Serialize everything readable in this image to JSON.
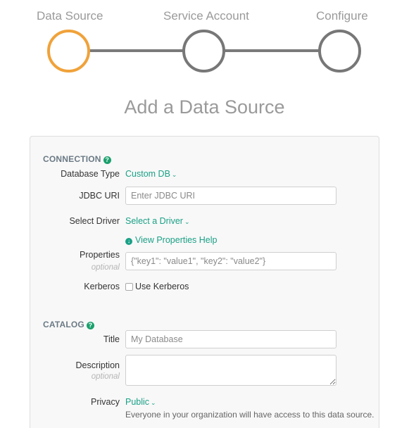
{
  "stepper": {
    "steps": [
      {
        "label": "Data Source"
      },
      {
        "label": "Service Account"
      },
      {
        "label": "Configure"
      }
    ]
  },
  "page_title": "Add a Data Source",
  "connection": {
    "heading": "CONNECTION",
    "database_type_label": "Database Type",
    "database_type_value": "Custom DB",
    "jdbc_uri_label": "JDBC URI",
    "jdbc_uri_placeholder": "Enter JDBC URI",
    "select_driver_label": "Select Driver",
    "select_driver_value": "Select a Driver",
    "view_properties_help": "View Properties Help",
    "properties_label": "Properties",
    "properties_sublabel": "optional",
    "properties_placeholder": "{\"key1\": \"value1\", \"key2\": \"value2\"}",
    "kerberos_label": "Kerberos",
    "use_kerberos_label": "Use Kerberos"
  },
  "catalog": {
    "heading": "CATALOG",
    "title_label": "Title",
    "title_placeholder": "My Database",
    "description_label": "Description",
    "description_sublabel": "optional",
    "privacy_label": "Privacy",
    "privacy_value": "Public",
    "privacy_help": "Everyone in your organization will have access to this data source."
  },
  "colors": {
    "active_step": "#f0a23a",
    "inactive_step": "#777777",
    "link": "#1aa086"
  }
}
